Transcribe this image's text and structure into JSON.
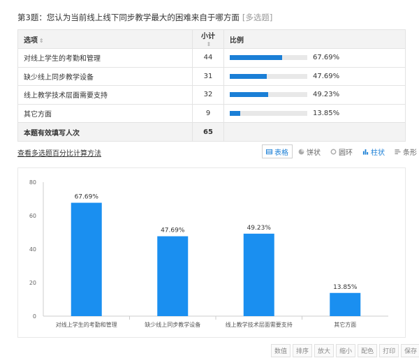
{
  "question": {
    "title": "第3题：您认为当前线上线下同步教学最大的困难来自于哪方面",
    "tag": "[多选题]"
  },
  "table": {
    "headers": {
      "option": "选项",
      "count": "小计",
      "ratio": "比例"
    },
    "rows": [
      {
        "option": "对线上学生的考勤和管理",
        "count": "44",
        "pct": "67.69%",
        "value": 67.69
      },
      {
        "option": "缺少线上同步教学设备",
        "count": "31",
        "pct": "47.69%",
        "value": 47.69
      },
      {
        "option": "线上教学技术层面需要支持",
        "count": "32",
        "pct": "49.23%",
        "value": 49.23
      },
      {
        "option": "其它方面",
        "count": "9",
        "pct": "13.85%",
        "value": 13.85
      }
    ],
    "total": {
      "label": "本题有效填写人次",
      "count": "65"
    }
  },
  "method_link": "查看多选题百分比计算方法",
  "view_tabs": [
    {
      "label": "表格",
      "icon": "table-icon"
    },
    {
      "label": "饼状",
      "icon": "pie-icon"
    },
    {
      "label": "圆环",
      "icon": "ring-icon"
    },
    {
      "label": "柱状",
      "icon": "bar-chart-icon"
    },
    {
      "label": "条形",
      "icon": "bar-horizontal-icon"
    }
  ],
  "footer_buttons": [
    "数值",
    "排序",
    "放大",
    "缩小",
    "配色",
    "打印",
    "保存"
  ],
  "colors": {
    "accent": "#1b7fd6",
    "bar": "#1a8ff0"
  },
  "chart_data": {
    "type": "bar",
    "categories": [
      "对线上学生的考勤和管理",
      "缺少线上同步教学设备",
      "线上教学技术层面需要支持",
      "其它方面"
    ],
    "values": [
      67.69,
      47.69,
      49.23,
      13.85
    ],
    "data_labels": [
      "67.69%",
      "47.69%",
      "49.23%",
      "13.85%"
    ],
    "ylim": [
      0,
      80
    ],
    "yticks": [
      0,
      20,
      40,
      60,
      80
    ],
    "grid": false,
    "xlabel": "",
    "ylabel": ""
  }
}
